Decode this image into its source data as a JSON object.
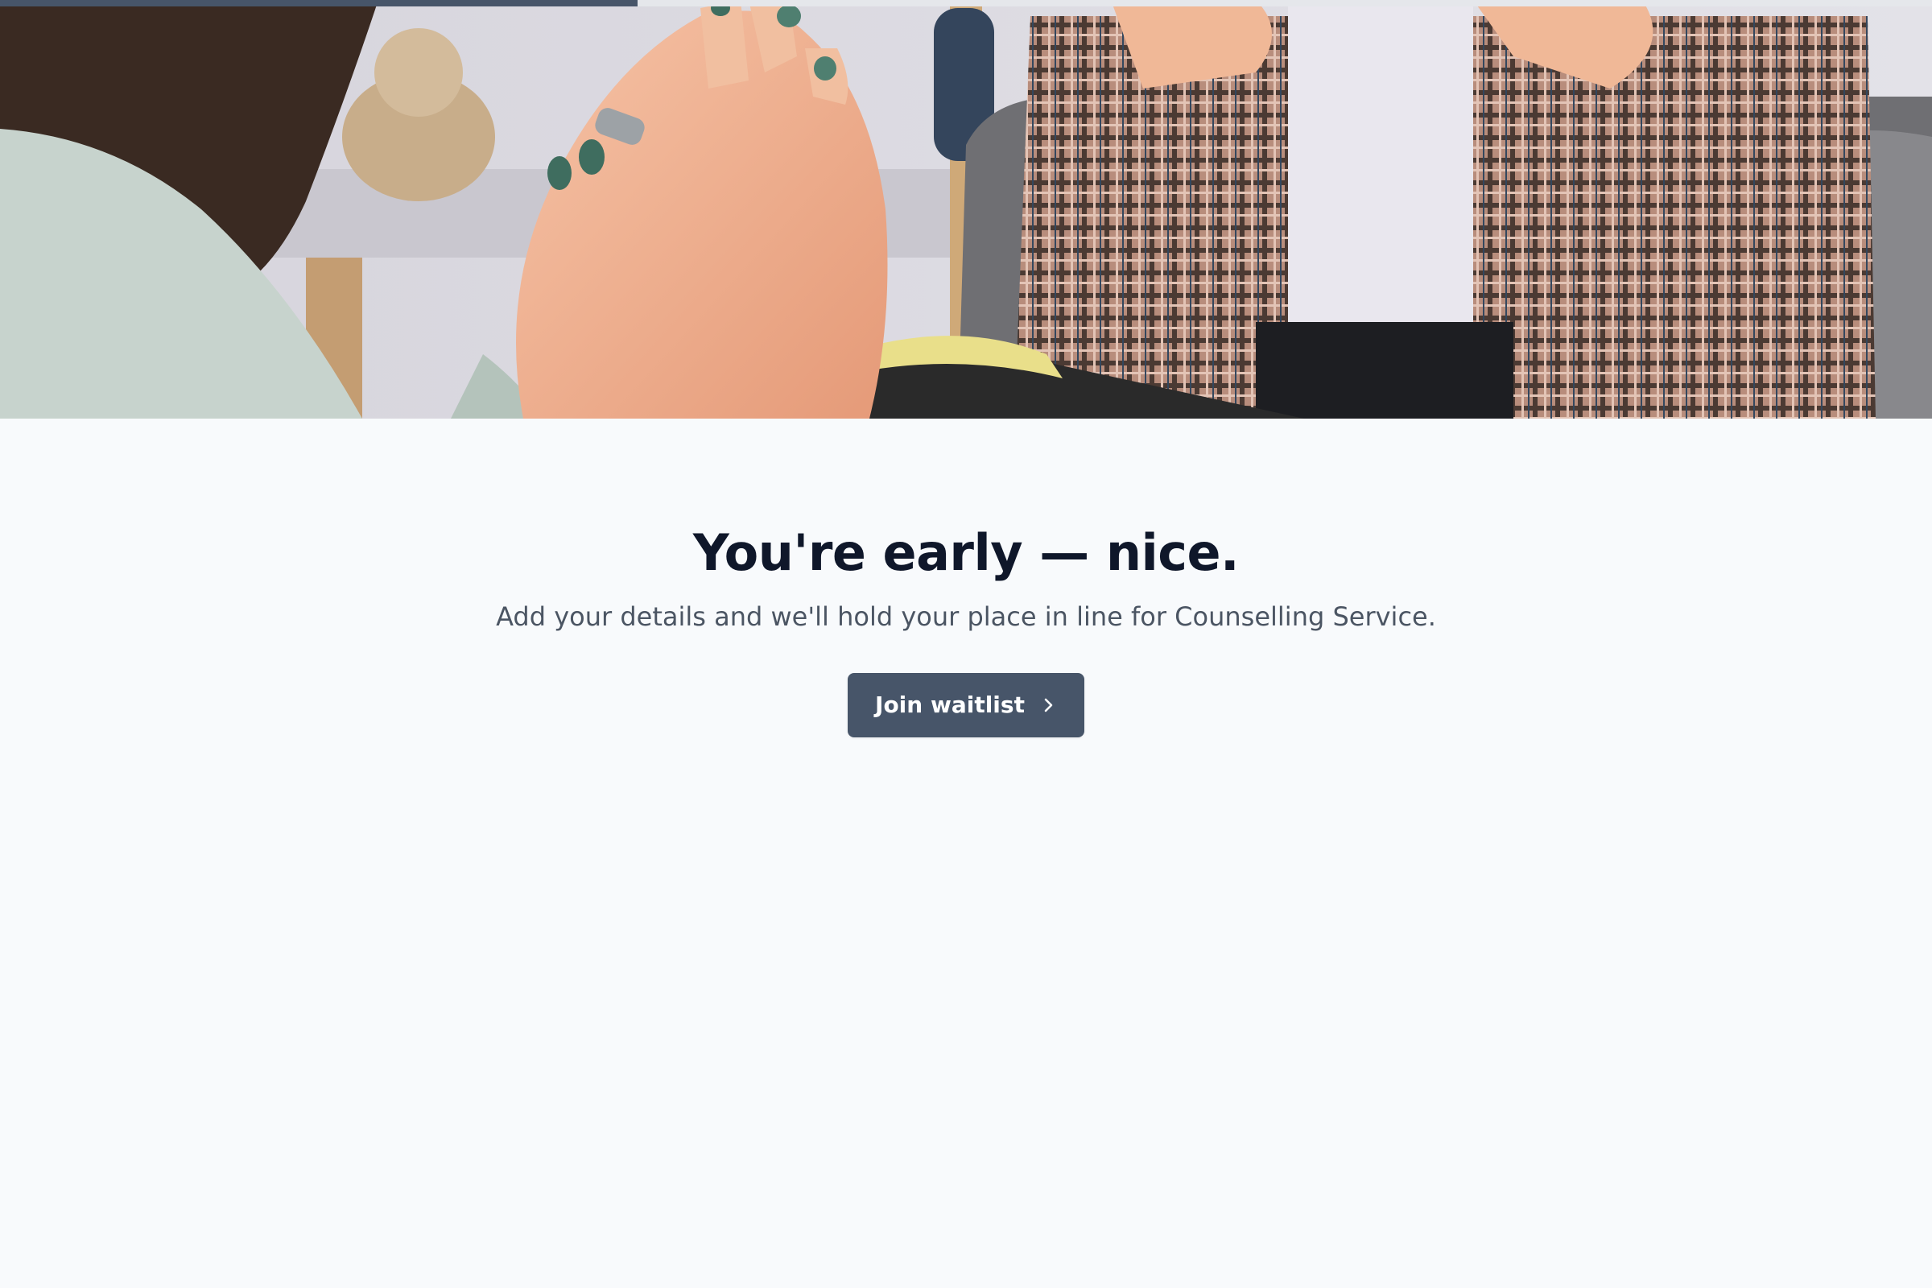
{
  "progress": {
    "value_percent": 33
  },
  "hero": {
    "image_icon": "photo-two-people-counselling-session"
  },
  "content": {
    "headline": "You're early — nice.",
    "subtitle": "Add your details and we'll hold your place in line for Counselling Service.",
    "cta_label": "Join waitlist",
    "cta_icon": "chevron-right-icon"
  },
  "colors": {
    "background": "#f8fafc",
    "accent": "#475569",
    "headline": "#0f172a",
    "subtitle": "#4b5563",
    "progress_track": "#e5e7eb"
  }
}
